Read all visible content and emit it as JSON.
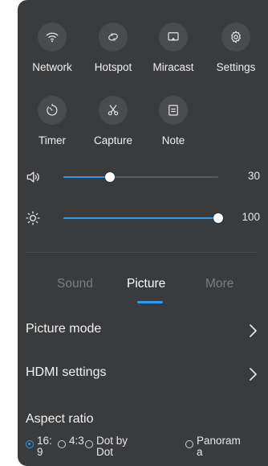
{
  "quick_tiles": [
    {
      "label": "Network",
      "icon": "wifi-icon"
    },
    {
      "label": "Hotspot",
      "icon": "hotspot-icon"
    },
    {
      "label": "Miracast",
      "icon": "cast-icon"
    },
    {
      "label": "Settings",
      "icon": "gear-icon"
    },
    {
      "label": "Timer",
      "icon": "timer-icon"
    },
    {
      "label": "Capture",
      "icon": "scissors-icon"
    },
    {
      "label": "Note",
      "icon": "note-icon"
    }
  ],
  "volume": {
    "icon": "speaker-icon",
    "value": "30",
    "level": 0.3
  },
  "brightness": {
    "icon": "brightness-icon",
    "value": "100",
    "level": 1.0
  },
  "tabs": [
    {
      "label": "Sound",
      "active": false
    },
    {
      "label": "Picture",
      "active": true
    },
    {
      "label": "More",
      "active": false
    }
  ],
  "menu": {
    "picture_mode": "Picture mode",
    "hdmi_settings": "HDMI settings"
  },
  "aspect_ratio": {
    "title": "Aspect ratio",
    "options": [
      {
        "label": "16:9",
        "selected": true
      },
      {
        "label": "4:3",
        "selected": false
      },
      {
        "label": "Dot by Dot",
        "selected": false
      },
      {
        "label": "Panorama",
        "selected": false
      }
    ]
  },
  "colors": {
    "accent": "#2c9bf0",
    "panel": "#3a3b3d",
    "tile": "#4a4b4e"
  }
}
